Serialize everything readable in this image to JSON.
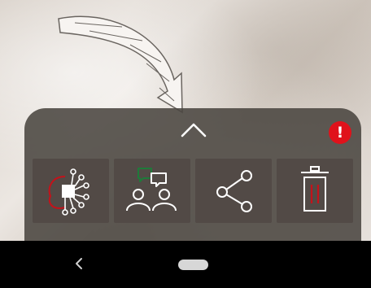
{
  "bottom_sheet": {
    "notification_badge": "!",
    "actions": [
      {
        "name": "ai",
        "icon": "ai-brain-icon",
        "label": "AI"
      },
      {
        "name": "chat",
        "icon": "people-chat-icon"
      },
      {
        "name": "share",
        "icon": "share-icon"
      },
      {
        "name": "delete",
        "icon": "trash-icon"
      }
    ]
  },
  "colors": {
    "sheet": "#4a4540",
    "button": "#524a46",
    "icon": "#ffffff",
    "badge": "#e0121b",
    "ai_accent": "#c4121a",
    "chat_accent": "#1f7a3a"
  },
  "nav": {
    "back_icon": "chevron-left-icon",
    "home_icon": "home-pill-icon"
  }
}
